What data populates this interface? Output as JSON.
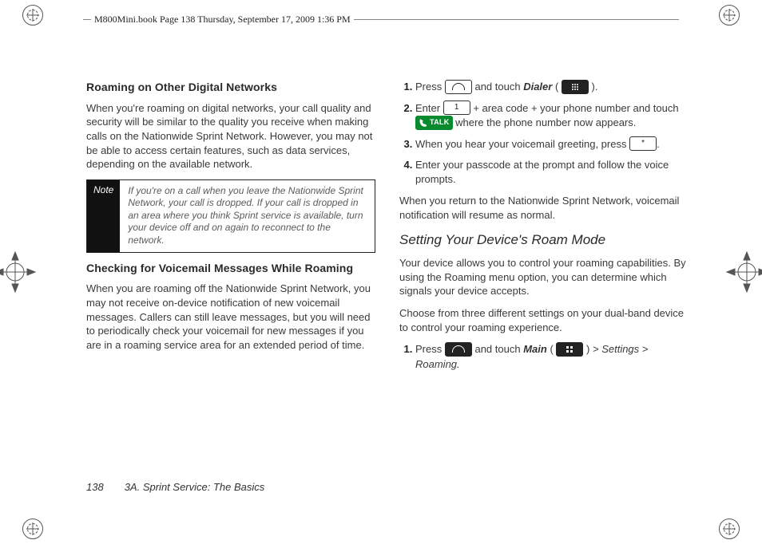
{
  "header": {
    "line": "M800Mini.book  Page 138  Thursday, September 17, 2009  1:36 PM"
  },
  "left": {
    "h_roaming": "Roaming on Other Digital Networks",
    "p_roaming": "When you're roaming on digital networks, your call quality and security will be similar to the quality you receive when making calls on the Nationwide Sprint Network. However, you may not be able to access certain features, such as data services, depending on the available network.",
    "note_label": "Note",
    "note_body": "If you're on a call when you leave the Nationwide Sprint Network, your call is dropped. If your call is dropped in an area where you think Sprint service is available, turn your device off and on again to reconnect to the network.",
    "h_vm": "Checking for Voicemail Messages While Roaming",
    "p_vm": "When you are roaming off the Nationwide Sprint Network, you may not receive on-device notification of new voicemail messages. Callers can still leave messages, but you will need to periodically check your voicemail for new messages if you are in a roaming service area for an extended period of time."
  },
  "right": {
    "step1_a": "Press ",
    "step1_b": " and touch ",
    "step1_dialer": "Dialer",
    "step1_c": " (",
    "step1_d": ").",
    "step2_a": "Enter ",
    "step2_b": " + area code + your phone number and touch ",
    "step2_talk": "TALK",
    "step2_c": " where the phone number now appears.",
    "step3_a": "When you hear your voicemail greeting, press ",
    "step3_key": "*",
    "step3_b": ".",
    "step4": "Enter your passcode at the prompt and follow the voice prompts.",
    "p_return": "When you return to the Nationwide Sprint Network, voicemail notification will resume as normal.",
    "h_roam_mode": "Setting Your Device's Roam Mode",
    "p_roam1": "Your device allows you to control your roaming capabilities. By using the Roaming menu option, you can determine which signals your device accepts.",
    "p_roam2": "Choose from three different settings on your dual-band device to control your roaming experience.",
    "rm_step1_a": "Press ",
    "rm_step1_b": " and touch ",
    "rm_step1_main": "Main",
    "rm_step1_c": " (",
    "rm_step1_d": ") ",
    "rm_step1_path": "> Settings > Roaming.",
    "one_key": "1"
  },
  "footer": {
    "page_number": "138",
    "title": "3A. Sprint Service: The Basics"
  }
}
